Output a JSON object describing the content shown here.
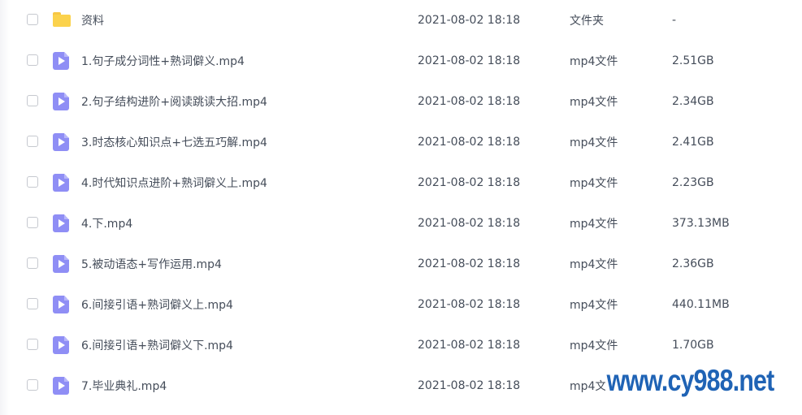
{
  "file_list": {
    "rows": [
      {
        "icon": "folder-icon",
        "name": "资料",
        "date": "2021-08-02 18:18",
        "type": "文件夹",
        "size": "-"
      },
      {
        "icon": "video-file-icon",
        "name": "1.句子成分词性+熟词僻义.mp4",
        "date": "2021-08-02 18:18",
        "type": "mp4文件",
        "size": "2.51GB"
      },
      {
        "icon": "video-file-icon",
        "name": "2.句子结构进阶+阅读跳读大招.mp4",
        "date": "2021-08-02 18:18",
        "type": "mp4文件",
        "size": "2.34GB"
      },
      {
        "icon": "video-file-icon",
        "name": "3.时态核心知识点+七选五巧解.mp4",
        "date": "2021-08-02 18:18",
        "type": "mp4文件",
        "size": "2.41GB"
      },
      {
        "icon": "video-file-icon",
        "name": "4.时代知识点进阶+熟词僻义上.mp4",
        "date": "2021-08-02 18:18",
        "type": "mp4文件",
        "size": "2.23GB"
      },
      {
        "icon": "video-file-icon",
        "name": "4.下.mp4",
        "date": "2021-08-02 18:18",
        "type": "mp4文件",
        "size": "373.13MB"
      },
      {
        "icon": "video-file-icon",
        "name": "5.被动语态+写作运用.mp4",
        "date": "2021-08-02 18:18",
        "type": "mp4文件",
        "size": "2.36GB"
      },
      {
        "icon": "video-file-icon",
        "name": "6.间接引语+熟词僻义上.mp4",
        "date": "2021-08-02 18:18",
        "type": "mp4文件",
        "size": "440.11MB"
      },
      {
        "icon": "video-file-icon",
        "name": "6.间接引语+熟词僻义下.mp4",
        "date": "2021-08-02 18:18",
        "type": "mp4文件",
        "size": "1.70GB"
      },
      {
        "icon": "video-file-icon",
        "name": "7.毕业典礼.mp4",
        "date": "2021-08-02 18:18",
        "type": "mp4文件",
        "size": ""
      }
    ]
  },
  "watermark": {
    "text": "www.cy988.net"
  },
  "colors": {
    "text": "#454d5a",
    "folder": "#fbd24c",
    "video_icon": "#8f8ef5",
    "watermark": "#1f63b5"
  }
}
